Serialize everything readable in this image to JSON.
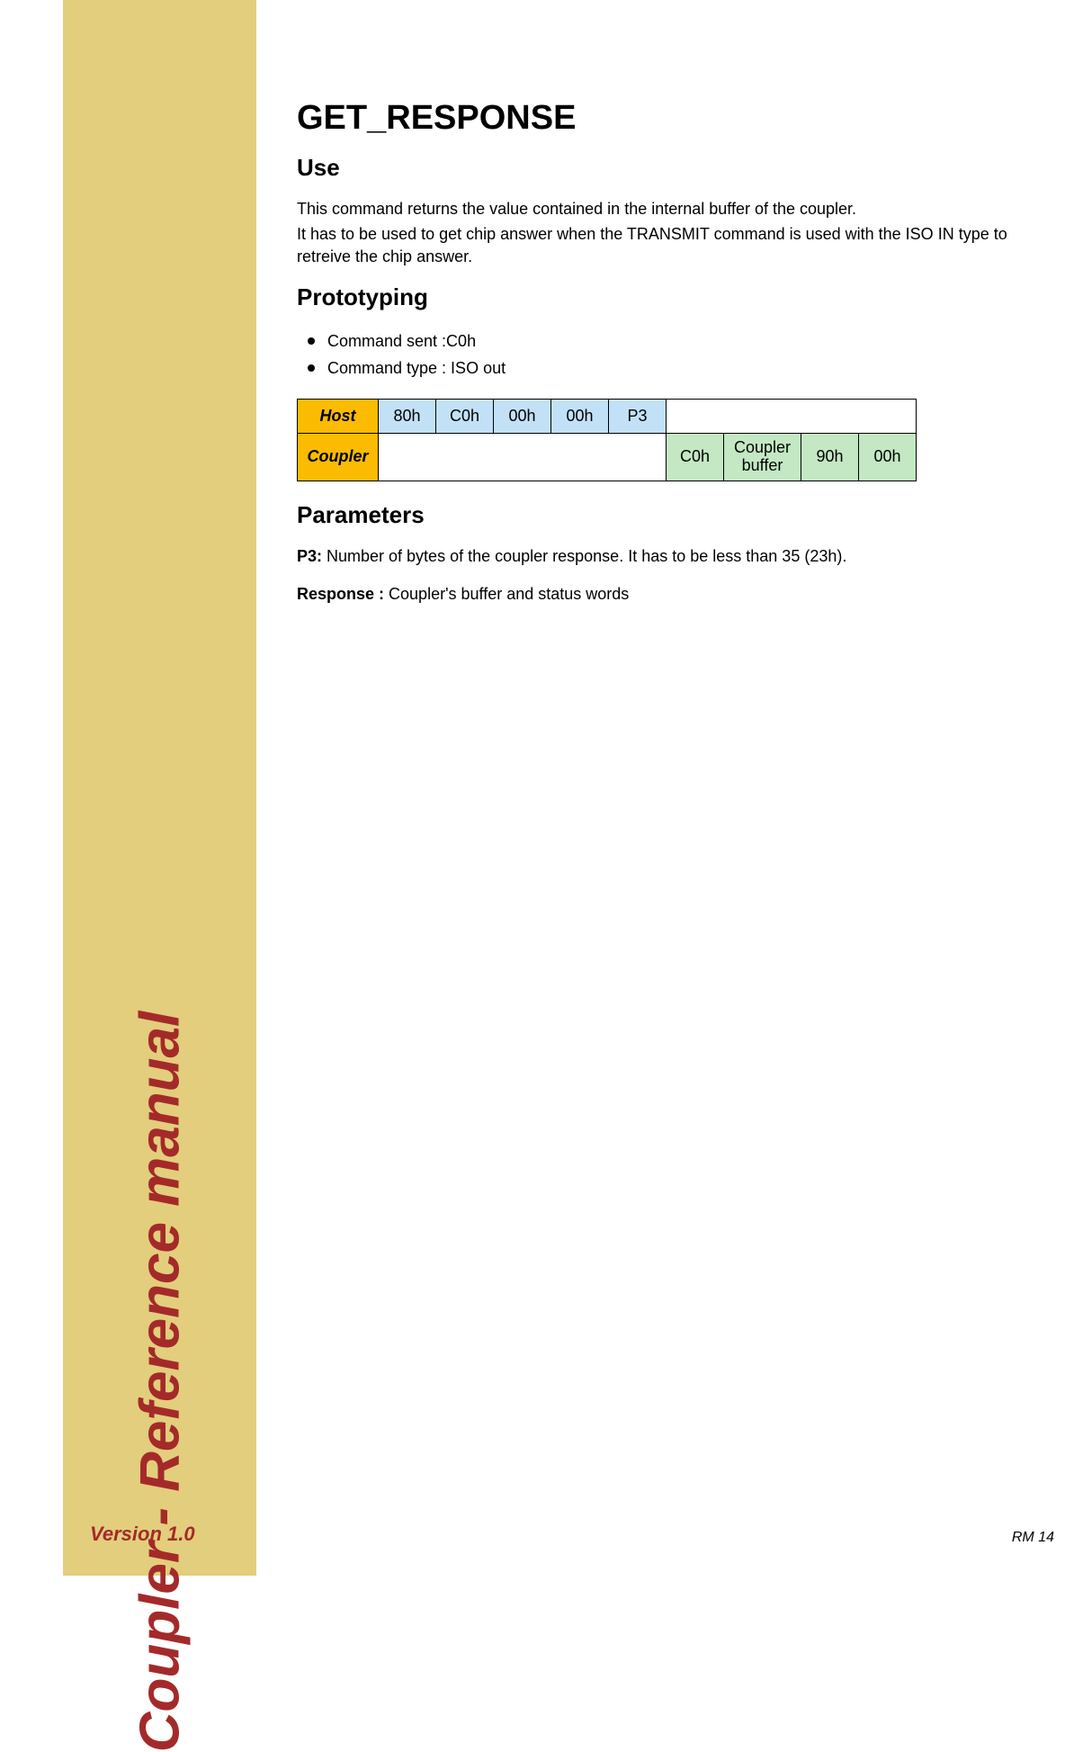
{
  "sidebar": {
    "title": "Coupler - Reference manual",
    "version": "Version 1.0"
  },
  "page": {
    "title": "GET_RESPONSE",
    "page_num": "RM 14"
  },
  "sections": {
    "use": {
      "heading": "Use",
      "line1": "This command returns the value contained in the internal buffer of the coupler.",
      "line2": "It has to be used to get chip answer when the TRANSMIT command is used with the ISO IN type to retreive the chip answer."
    },
    "prototyping": {
      "heading": "Prototyping",
      "bullets": [
        "Command sent :C0h",
        "Command type : ISO out"
      ],
      "table": {
        "host_label": "Host",
        "coupler_label": "Coupler",
        "host_cells": [
          "80h",
          "C0h",
          "00h",
          "00h",
          "P3"
        ],
        "coupler_cells": [
          "C0h",
          "Coupler buffer",
          "90h",
          "00h"
        ]
      }
    },
    "parameters": {
      "heading": "Parameters",
      "p3_label": "P3:",
      "p3_text": " Number of bytes of the coupler response. It has to be less than 35 (23h).",
      "response_label": "Response :",
      "response_text": " Coupler's buffer and status words"
    }
  }
}
